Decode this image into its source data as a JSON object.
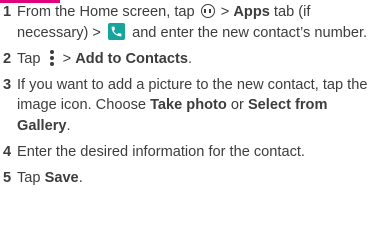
{
  "accent_color": "#e3007b",
  "phone_icon_color": "#16a59d",
  "steps": [
    {
      "num": "1",
      "t1": "From the Home screen, tap",
      "icon1": "apps-circle-icon",
      "t2": ">",
      "b1": "Apps",
      "t3": "tab (if necessary) >",
      "icon2": "phone-icon",
      "t4": "and enter the new contact’s number."
    },
    {
      "num": "2",
      "t1": "Tap",
      "icon1": "menu-icon",
      "t2": ">",
      "b1": "Add to Contacts",
      "t3": "."
    },
    {
      "num": "3",
      "t1": "If you want to add a picture to the new contact, tap the image icon. Choose",
      "b1": "Take photo",
      "t2": "or",
      "b2": "Select from Gallery",
      "t3": "."
    },
    {
      "num": "4",
      "t1": "Enter the desired information for the contact."
    },
    {
      "num": "5",
      "t1": "Tap",
      "b1": "Save",
      "t2": "."
    }
  ]
}
